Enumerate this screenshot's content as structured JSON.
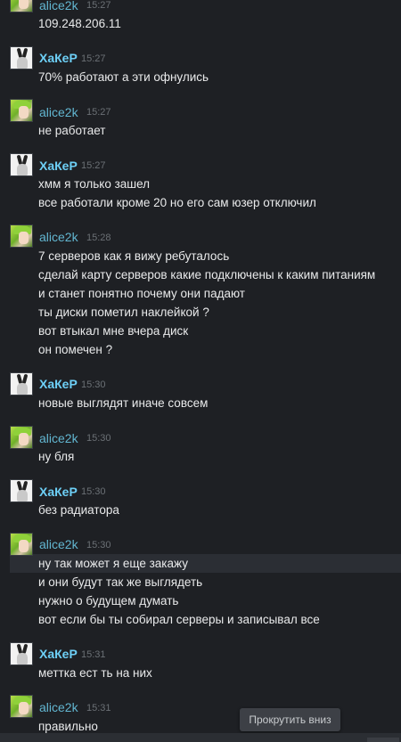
{
  "messages": [
    {
      "author": "alice2k",
      "time": "15:27",
      "lines": [
        "109.248.206.11"
      ]
    },
    {
      "author": "ХаКеР",
      "time": "15:27",
      "lines": [
        "70% работают а эти офнулись"
      ]
    },
    {
      "author": "alice2k",
      "time": "15:27",
      "lines": [
        "не работает"
      ]
    },
    {
      "author": "ХаКеР",
      "time": "15:27",
      "lines": [
        "хмм я только зашел",
        "все работали кроме 20 но его сам юзер отключил"
      ]
    },
    {
      "author": "alice2k",
      "time": "15:28",
      "lines": [
        "7 серверов как я вижу ребуталось",
        "сделай карту серверов какие подключены к каким питаниям",
        "и станет понятно почему они падают",
        "ты диски пометил наклейкой ?",
        "вот втыкал мне вчера диск",
        "он помечен ?"
      ]
    },
    {
      "author": "ХаКеР",
      "time": "15:30",
      "lines": [
        "новые выглядят иначе совсем"
      ]
    },
    {
      "author": "alice2k",
      "time": "15:30",
      "lines": [
        "ну бля"
      ]
    },
    {
      "author": "ХаКеР",
      "time": "15:30",
      "lines": [
        "без радиатора"
      ]
    },
    {
      "author": "alice2k",
      "time": "15:30",
      "lines": [
        "ну так может я еще закажу",
        "и они будут так же выглядеть",
        "нужно о будущем думать",
        "вот если бы ты собирал серверы и записывал все"
      ]
    },
    {
      "author": "ХаКеР",
      "time": "15:31",
      "lines": [
        "меттка ест ть на них"
      ]
    },
    {
      "author": "alice2k",
      "time": "15:31",
      "lines": [
        "правильно"
      ]
    }
  ],
  "scroll_button_label": "Прокрутить вниз",
  "colors": {
    "background": "#1e2024",
    "alice_name": "#62b6d1",
    "hacker_name": "#6dcff6"
  }
}
